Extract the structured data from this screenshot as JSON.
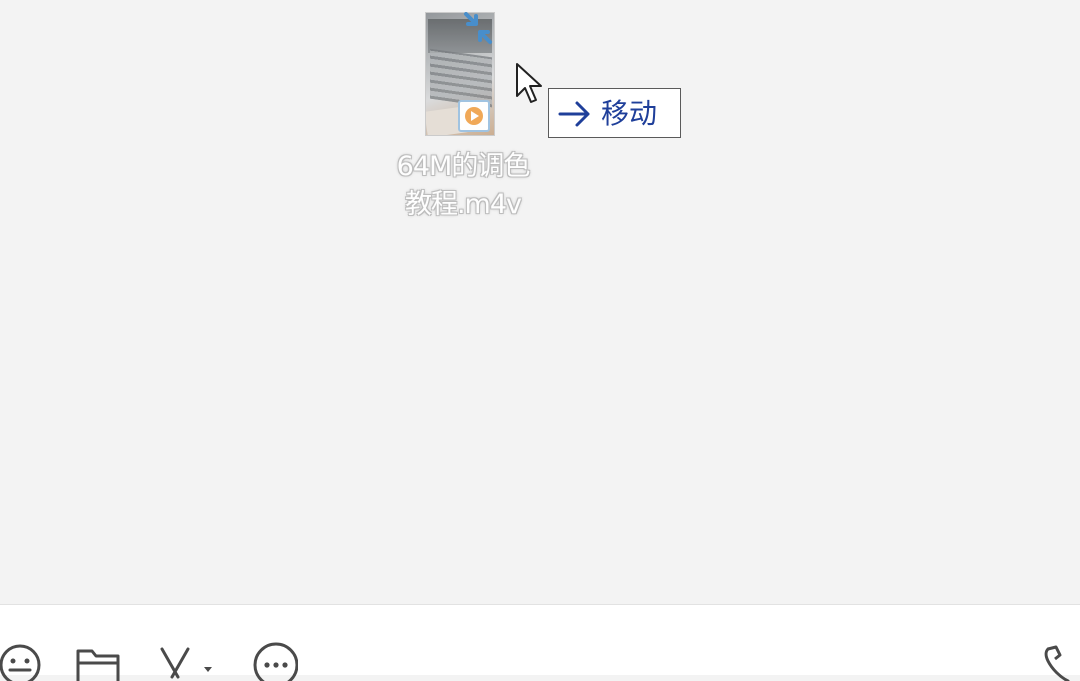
{
  "drag": {
    "file_name_line1": "64M的调色",
    "file_name_line2": "教程.m4v",
    "drop_effect_label": "移动"
  },
  "toolbar": {
    "icons": [
      "emoji-icon",
      "folder-icon",
      "scissors-icon",
      "chevron-down-icon",
      "more-icon",
      "phone-icon"
    ]
  },
  "colors": {
    "background": "#f3f3f3",
    "toolbar_bg": "#ffffff",
    "tooltip_text": "#1f3f9a",
    "icon_stroke": "#4a4a4a",
    "play_badge": "#f0a24a"
  }
}
